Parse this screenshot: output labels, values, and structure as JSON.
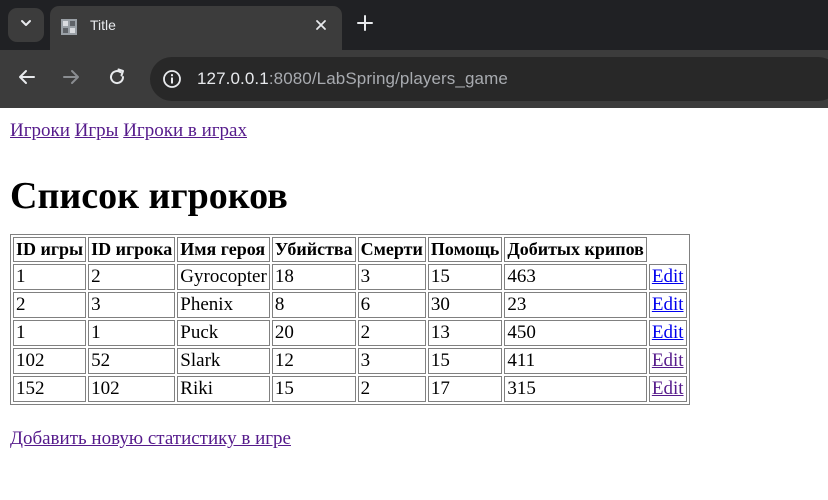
{
  "browser": {
    "tab_title": "Title",
    "url_host": "127.0.0.1",
    "url_rest": ":8080/LabSpring/players_game"
  },
  "nav_links": [
    {
      "label": "Игроки"
    },
    {
      "label": "Игры"
    },
    {
      "label": "Игроки в играх"
    }
  ],
  "page": {
    "heading": "Список игроков",
    "add_link": "Добавить новую статистику в игре"
  },
  "table": {
    "headers": [
      "ID игры",
      "ID игрока",
      "Имя героя",
      "Убийства",
      "Смерти",
      "Помощь",
      "Добитых крипов"
    ],
    "edit_label": "Edit",
    "rows": [
      {
        "cells": [
          "1",
          "2",
          "Gyrocopter",
          "18",
          "3",
          "15",
          "463"
        ],
        "visited": false
      },
      {
        "cells": [
          "2",
          "3",
          "Phenix",
          "8",
          "6",
          "30",
          "23"
        ],
        "visited": false
      },
      {
        "cells": [
          "1",
          "1",
          "Puck",
          "20",
          "2",
          "13",
          "450"
        ],
        "visited": false
      },
      {
        "cells": [
          "102",
          "52",
          "Slark",
          "12",
          "3",
          "15",
          "411"
        ],
        "visited": true
      },
      {
        "cells": [
          "152",
          "102",
          "Riki",
          "15",
          "2",
          "17",
          "315"
        ],
        "visited": true
      }
    ]
  },
  "colors": {
    "visited_link": "#551a8b",
    "unvisited_link": "#0000ee",
    "chrome_dark": "#202124",
    "chrome_toolbar": "#3c3c3c"
  }
}
